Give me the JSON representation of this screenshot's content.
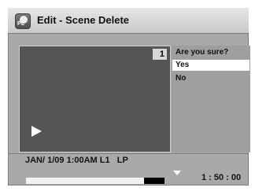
{
  "title_bar": {
    "icon": "pl-disc-icon",
    "icon_label": "PL",
    "title": "Edit - Scene Delete"
  },
  "preview": {
    "scene_number": "1",
    "play_icon": "play-icon"
  },
  "confirm_menu": {
    "question": "Are you sure?",
    "options": [
      "Yes",
      "No"
    ],
    "selected_index": 0
  },
  "status_bar": {
    "info": "JAN/ 1/09 1:00AM L1   LP"
  },
  "playback": {
    "time": "1 : 50 : 00",
    "progress_fraction": 0.85
  }
}
